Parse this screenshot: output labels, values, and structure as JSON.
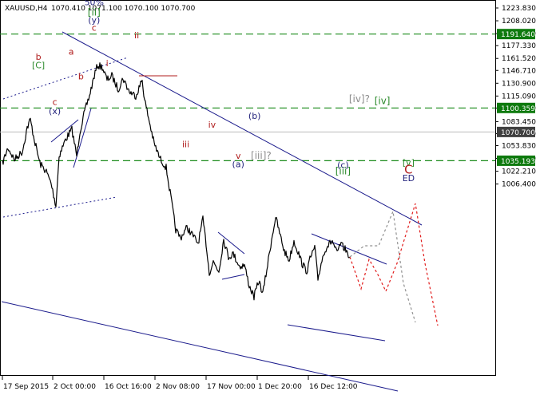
{
  "header": {
    "symbol": "XAUUSD,H4",
    "ohlc": "1070.410 1071.100 1070.100 1070.700"
  },
  "colors": {
    "background": "#ffffff",
    "price": "#000000",
    "level_line": "#1a8a1a",
    "channel": "#1b1b8c",
    "projection_red": "#e11b1b",
    "projection_grey": "#909090",
    "wave_red": "#b01c1c",
    "wave_navy": "#24247d",
    "wave_green": "#2b8a2b",
    "wave_grey": "#8c8c8c",
    "tag_green": "#0e7a0e",
    "tag_grey": "#404040"
  },
  "chart_data": {
    "type": "line",
    "symbol": "XAUUSD",
    "timeframe": "H4",
    "ylim": [
      1005.0,
      1232.0
    ],
    "y_ticks": [
      "1223.830",
      "1208.020",
      "1192.210",
      "1177.330",
      "1161.520",
      "1146.710",
      "1130.900",
      "1115.090",
      "1100.280",
      "1083.450",
      "1068.640",
      "1053.830",
      "1038.020",
      "1022.210",
      "1006.400"
    ],
    "x_ticks": [
      "17 Sep 2015",
      "2 Oct 00:00",
      "16 Oct 16:00",
      "2 Nov 08:00",
      "17 Nov 00:00",
      "1 Dec 20:00",
      "16 Dec 12:00"
    ],
    "levels": [
      {
        "value": 1191.64,
        "label": "1191.640"
      },
      {
        "value": 1100.359,
        "label": "1100.359"
      },
      {
        "value": 1035.193,
        "label": "1035.193"
      }
    ],
    "current_price": {
      "value": 1070.7,
      "label": "1070.700"
    },
    "fib_label": "50%",
    "wave_labels": [
      {
        "text": "b",
        "x": "28 Sep",
        "y": 1160.0,
        "color": "wave_red"
      },
      {
        "text": "[C]",
        "x": "28 Sep",
        "y": 1149.5,
        "color": "wave_green"
      },
      {
        "text": "a",
        "x": "8 Oct",
        "y": 1166.0,
        "color": "wave_red"
      },
      {
        "text": "b",
        "x": "11 Oct",
        "y": 1135.5,
        "color": "wave_red"
      },
      {
        "text": "c",
        "x": "3 Oct",
        "y": 1104.0,
        "color": "wave_red"
      },
      {
        "text": "(x)",
        "x": "3 Oct",
        "y": 1093.0,
        "color": "wave_navy"
      },
      {
        "text": "50%",
        "x": "15 Oct",
        "y": 1227.5,
        "color": "wave_navy"
      },
      {
        "text": "[ii]",
        "x": "15 Oct",
        "y": 1214.5,
        "color": "wave_green"
      },
      {
        "text": "(y)",
        "x": "15 Oct",
        "y": 1205.0,
        "color": "wave_navy"
      },
      {
        "text": "c",
        "x": "15 Oct",
        "y": 1195.8,
        "color": "wave_red"
      },
      {
        "text": "i",
        "x": "19 Oct",
        "y": 1152.0,
        "color": "wave_red"
      },
      {
        "text": "ii",
        "x": "28 Oct",
        "y": 1186.5,
        "color": "wave_red"
      },
      {
        "text": "iv",
        "x": "20 Nov",
        "y": 1076.0,
        "color": "wave_red"
      },
      {
        "text": "iii",
        "x": "12 Nov",
        "y": 1052.0,
        "color": "wave_red"
      },
      {
        "text": "v",
        "x": "28 Nov",
        "y": 1037.5,
        "color": "wave_red"
      },
      {
        "text": "(a)",
        "x": "28 Nov",
        "y": 1027.0,
        "color": "wave_navy"
      },
      {
        "text": "[iii]?",
        "x": "5 Dec",
        "y": 1037.5,
        "color": "wave_grey"
      },
      {
        "text": "(b)",
        "x": "3 Dec",
        "y": 1087.0,
        "color": "wave_navy"
      },
      {
        "text": "[iv]?",
        "x": "4 Jan",
        "y": 1107.5,
        "color": "wave_grey"
      },
      {
        "text": "[iv]",
        "x": "11 Jan",
        "y": 1105.0,
        "color": "wave_green"
      },
      {
        "text": "(c)",
        "x": "30 Dec",
        "y": 1026.0,
        "color": "wave_navy"
      },
      {
        "text": "[iii]",
        "x": "30 Dec",
        "y": 1018.5,
        "color": "wave_green"
      },
      {
        "text": "[v]",
        "x": "19 Jan",
        "y": 1029.0,
        "color": "wave_green"
      },
      {
        "text": "C",
        "x": "19 Jan",
        "y": 1019.5,
        "color": "wave_red"
      },
      {
        "text": "ED",
        "x": "19 Jan",
        "y": 1010.0,
        "color": "wave_navy"
      }
    ]
  }
}
